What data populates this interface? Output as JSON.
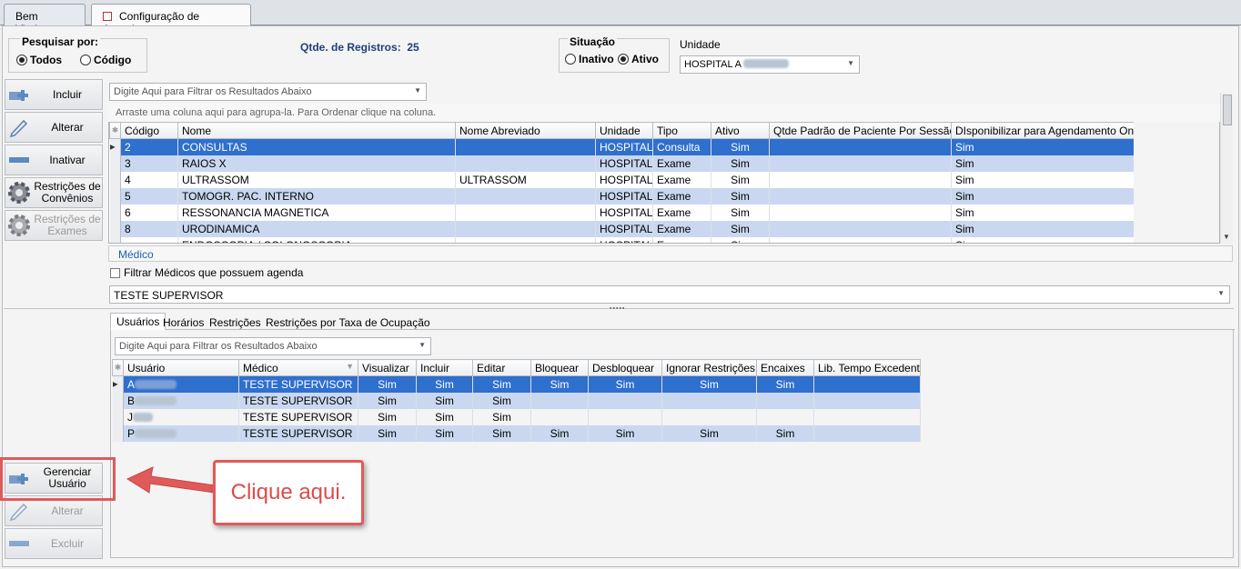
{
  "tabs": [
    {
      "label": "Bem Vindo"
    },
    {
      "label": "Configuração de Agenda"
    }
  ],
  "search": {
    "title": "Pesquisar por:",
    "opt_all": "Todos",
    "opt_code": "Código",
    "records_label": "Qtde. de Registros:",
    "records_count": "25"
  },
  "situacao": {
    "title": "Situação",
    "opt_inactive": "Inativo",
    "opt_active": "Ativo"
  },
  "unidade": {
    "label": "Unidade",
    "value": "HOSPITAL A"
  },
  "side_buttons": {
    "incluir": "Incluir",
    "alterar": "Alterar",
    "inativar": "Inativar",
    "restr_convenios": "Restrições de Convênios",
    "restr_exames": "Restrições de Exames",
    "gerenciar": "Gerenciar Usuário",
    "alterar2": "Alterar",
    "excluir": "Excluir"
  },
  "filter_placeholder": "Digite Aqui para Filtrar os Resultados Abaixo",
  "group_hint": "Arraste uma coluna aqui para agrupa-la. Para Ordenar clique na coluna.",
  "main_grid": {
    "columns": [
      "Código",
      "Nome",
      "Nome Abreviado",
      "Unidade",
      "Tipo",
      "Ativo",
      "Qtde Padrão de Paciente Por Sessão",
      "DIsponibilizar para Agendamento Online"
    ],
    "rows": [
      [
        "2",
        "CONSULTAS",
        "",
        "HOSPITAL",
        "Consulta",
        "Sim",
        "",
        "Sim"
      ],
      [
        "3",
        "RAIOS X",
        "",
        "HOSPITAL",
        "Exame",
        "Sim",
        "",
        "Sim"
      ],
      [
        "4",
        "ULTRASSOM",
        "ULTRASSOM",
        "HOSPITAL",
        "Exame",
        "Sim",
        "",
        "Sim"
      ],
      [
        "5",
        "TOMOGR. PAC. INTERNO",
        "",
        "HOSPITAL",
        "Exame",
        "Sim",
        "",
        "Sim"
      ],
      [
        "6",
        "RESSONANCIA MAGNETICA",
        "",
        "HOSPITAL",
        "Exame",
        "Sim",
        "",
        "Sim"
      ],
      [
        "8",
        "URODINAMICA",
        "",
        "HOSPITAL",
        "Exame",
        "Sim",
        "",
        "Sim"
      ],
      [
        "",
        "ENDOSCOPIA / COLONOSCOPIA",
        "",
        "HOSPITAL",
        "Exame",
        "Sim",
        "",
        "Sim"
      ]
    ]
  },
  "medico": {
    "title": "Médico",
    "checkbox_label": "Filtrar Médicos que possuem agenda",
    "value": "TESTE SUPERVISOR"
  },
  "sub_tabs": [
    {
      "label": "Usuários"
    },
    {
      "label": "Horários"
    },
    {
      "label": "Restrições"
    },
    {
      "label": "Restrições por Taxa de Ocupação"
    }
  ],
  "user_grid": {
    "columns": [
      "Usuário",
      "Médico",
      "Visualizar",
      "Incluir",
      "Editar",
      "Bloquear",
      "Desbloquear",
      "Ignorar Restrições",
      "Encaixes",
      "Lib. Tempo Excedente"
    ],
    "rows": [
      [
        "A",
        "TESTE SUPERVISOR",
        "Sim",
        "Sim",
        "Sim",
        "Sim",
        "Sim",
        "Sim",
        "Sim",
        ""
      ],
      [
        "B",
        "TESTE SUPERVISOR",
        "Sim",
        "Sim",
        "Sim",
        "",
        "",
        "",
        "",
        ""
      ],
      [
        "J",
        "TESTE SUPERVISOR",
        "Sim",
        "Sim",
        "Sim",
        "",
        "",
        "",
        "",
        ""
      ],
      [
        "P",
        "TESTE SUPERVISOR",
        "Sim",
        "Sim",
        "Sim",
        "Sim",
        "Sim",
        "Sim",
        "Sim",
        ""
      ]
    ]
  },
  "callout": "Clique aqui."
}
